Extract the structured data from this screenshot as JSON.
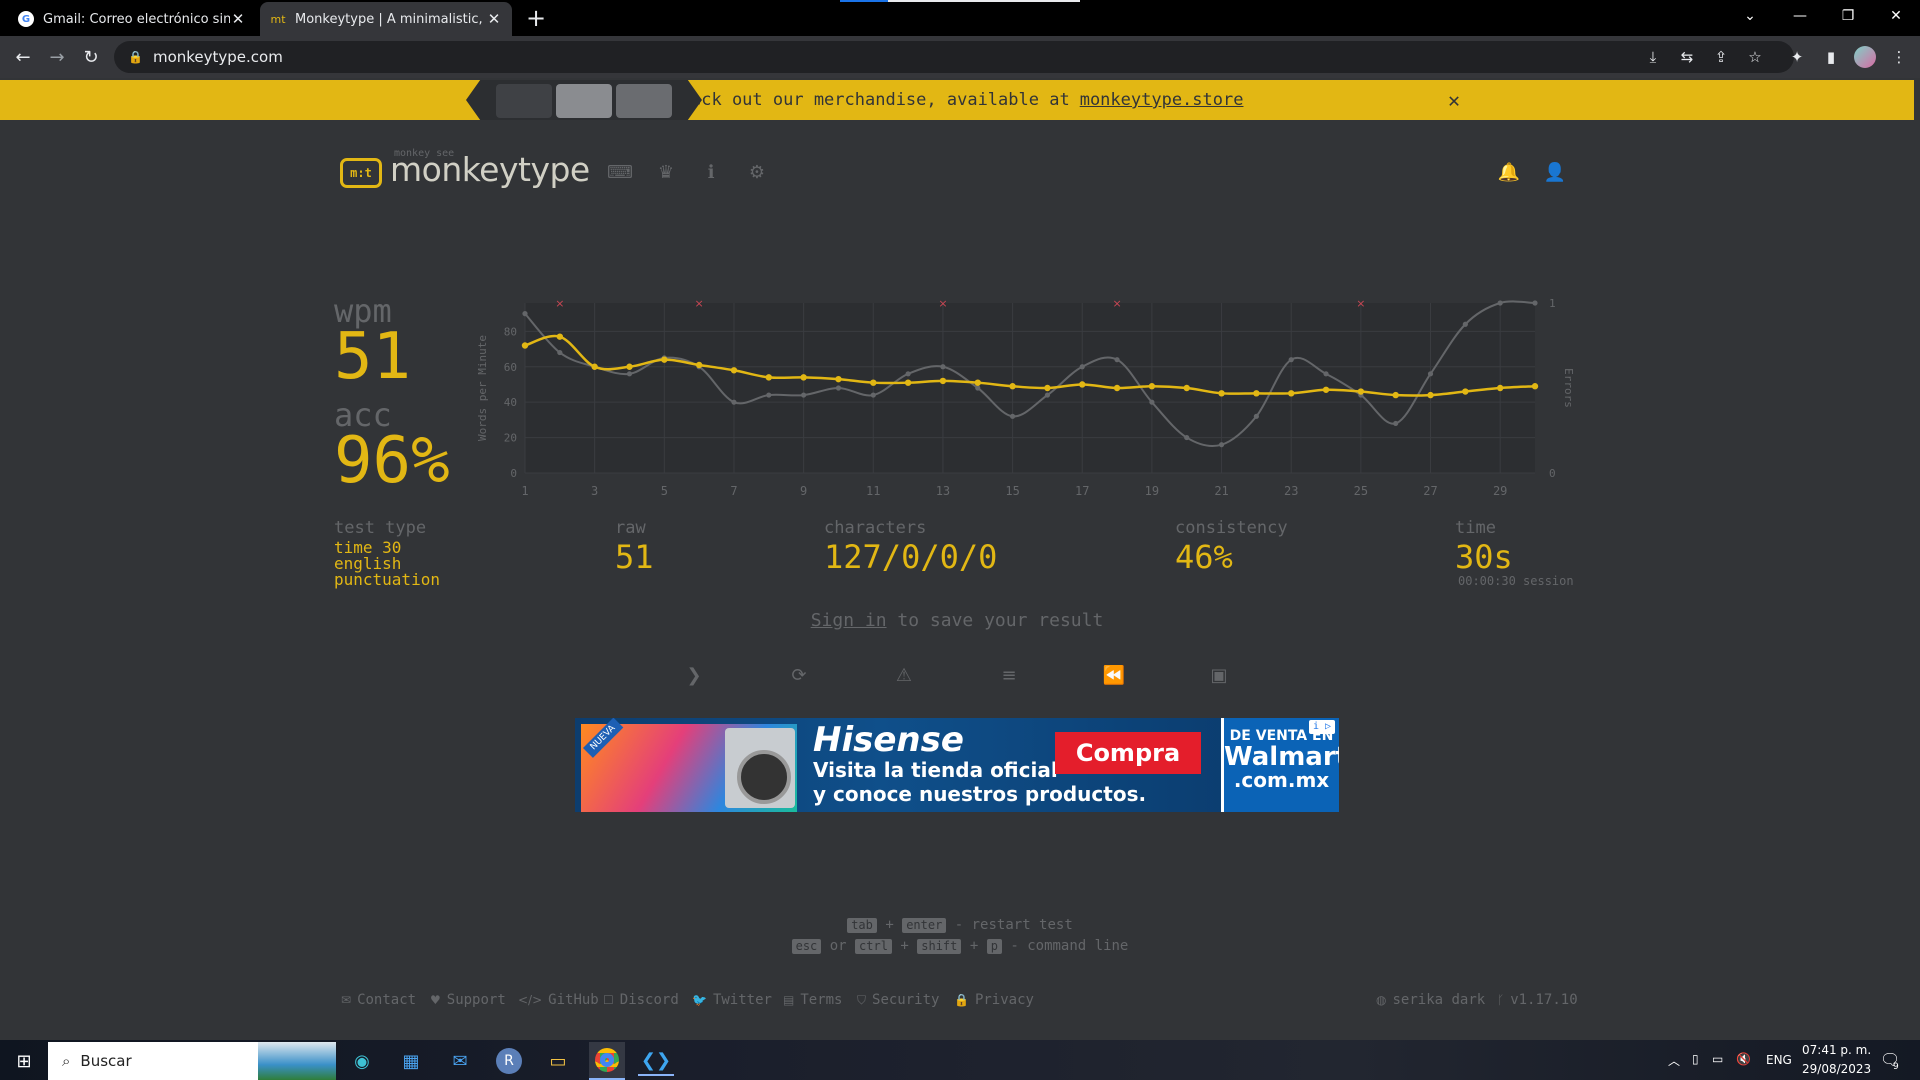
{
  "browser": {
    "tabs": [
      {
        "title": "Gmail: Correo electrónico sin coste,",
        "icon": "google-g-icon"
      },
      {
        "title": "Monkeytype | A minimalistic, custom",
        "icon": "mt",
        "active": true
      }
    ],
    "new_tab": "+",
    "url": "monkeytype.com"
  },
  "banner": {
    "text": "Check out our merchandise, available at",
    "link": "monkeytype.store",
    "close": "✕"
  },
  "header": {
    "logo_icon_text": "m:t",
    "logo_top": "monkey see",
    "logo_text": "monkeytype"
  },
  "result": {
    "wpm_label": "wpm",
    "wpm": "51",
    "acc_label": "acc",
    "acc": "96%",
    "test_type_label": "test type",
    "test_type": [
      "time 30",
      "english",
      "punctuation"
    ],
    "raw_label": "raw",
    "raw": "51",
    "characters_label": "characters",
    "characters": "127/0/0/0",
    "consistency_label": "consistency",
    "consistency": "46%",
    "time_label": "time",
    "time": "30s",
    "time_sub": "00:00:30 session",
    "signin_link": "Sign in",
    "signin_rest": "to save your result"
  },
  "chart_data": {
    "type": "line",
    "x": [
      1,
      2,
      3,
      4,
      5,
      6,
      7,
      8,
      9,
      10,
      11,
      12,
      13,
      14,
      15,
      16,
      17,
      18,
      19,
      20,
      21,
      22,
      23,
      24,
      25,
      26,
      27,
      28,
      29,
      30
    ],
    "xticks": [
      1,
      3,
      5,
      7,
      9,
      11,
      13,
      15,
      17,
      19,
      21,
      23,
      25,
      27,
      29
    ],
    "ylabel": "Words per Minute",
    "yticks": [
      0,
      20,
      40,
      60,
      80
    ],
    "ylim": [
      0,
      96
    ],
    "y2label": "Errors",
    "y2ticks": [
      0,
      1
    ],
    "series": [
      {
        "values": [
          90,
          68,
          60,
          56,
          65,
          60,
          40,
          44,
          44,
          48,
          44,
          56,
          60,
          48,
          32,
          44,
          60,
          64,
          40,
          20,
          16,
          32,
          64,
          56,
          44,
          28,
          56,
          84,
          96,
          96
        ],
        "color": "#646669"
      },
      {
        "values": [
          72,
          77,
          60,
          60,
          64,
          61,
          58,
          54,
          54,
          53,
          51,
          51,
          52,
          51,
          49,
          48,
          50,
          48,
          49,
          48,
          45,
          45,
          45,
          47,
          46,
          44,
          44,
          46,
          48,
          49
        ],
        "color": "#e2b714"
      }
    ],
    "error_markers_x": [
      2,
      6,
      13,
      18,
      25
    ],
    "colors": {
      "bg": "#2c2e31",
      "grid": "#3a3c40",
      "text": "#646669",
      "error": "#ca4754"
    }
  },
  "controls": [
    {
      "name": "next-test-button",
      "glyph": "❯"
    },
    {
      "name": "repeat-test-button",
      "glyph": "⟳"
    },
    {
      "name": "practice-words-button",
      "glyph": "⚠"
    },
    {
      "name": "toggle-words-history-button",
      "glyph": "≡"
    },
    {
      "name": "watch-replay-button",
      "glyph": "⏪"
    },
    {
      "name": "save-screenshot-button",
      "glyph": "▣"
    }
  ],
  "ad": {
    "badge": "NUEVA",
    "brand": "Hisense",
    "line1": "Visita la tienda oficial",
    "line2": "y conoce nuestros productos.",
    "cta": "Compra",
    "side1": "DE VENTA EN",
    "side2": "Walmart",
    "side3": ".com.mx",
    "info": "i ▷"
  },
  "hints": {
    "k_tab": "tab",
    "plus": "+",
    "k_enter": "enter",
    "restart": "- restart test",
    "k_esc": "esc",
    "or": "or",
    "k_ctrl": "ctrl",
    "k_shift": "shift",
    "k_p": "p",
    "command": "- command line"
  },
  "footer": {
    "links": [
      {
        "label": "Contact",
        "icon": "✉"
      },
      {
        "label": "Support",
        "icon": "♥"
      },
      {
        "label": "GitHub",
        "icon": "</>"
      },
      {
        "label": "Discord",
        "icon": "☐"
      },
      {
        "label": "Twitter",
        "icon": "🐦"
      },
      {
        "label": "Terms",
        "icon": "▤"
      },
      {
        "label": "Security",
        "icon": "⛉"
      },
      {
        "label": "Privacy",
        "icon": "🔒"
      }
    ],
    "theme": "serika dark",
    "version": "v1.17.10"
  },
  "taskbar": {
    "search_placeholder": "Buscar",
    "lang": "ENG",
    "time": "07:41 p. m.",
    "date": "29/08/2023",
    "notif": "9"
  }
}
